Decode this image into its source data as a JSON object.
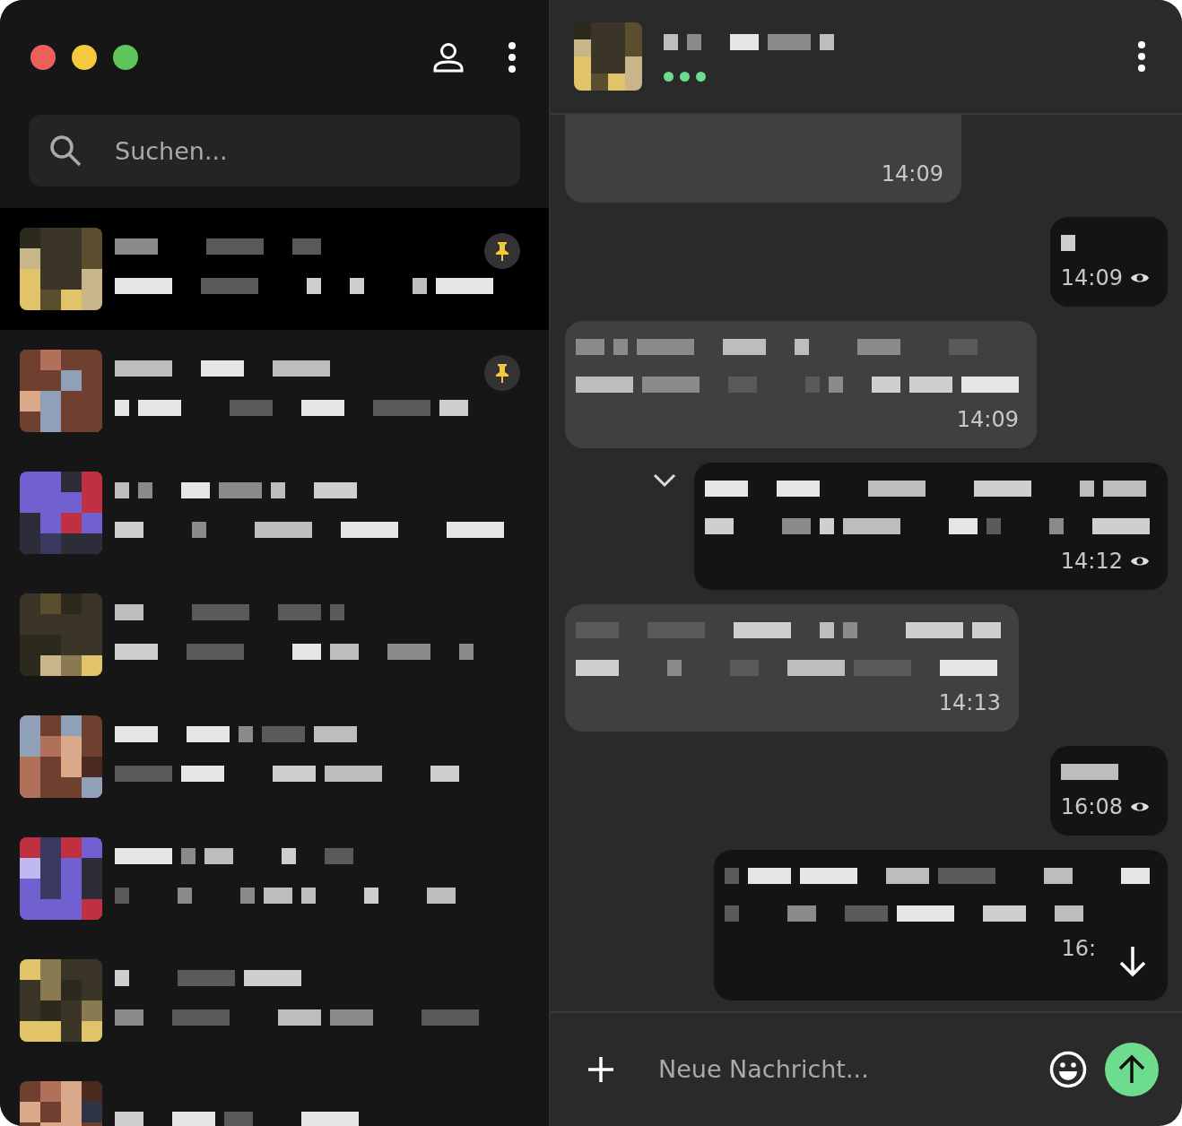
{
  "window": {
    "controls": [
      {
        "color": "#ee5f5b"
      },
      {
        "color": "#f5c93c"
      },
      {
        "color": "#5dc55a"
      }
    ]
  },
  "sidebar": {
    "search": {
      "placeholder": "Suchen..."
    },
    "chats": [
      {
        "selected": true,
        "pinned": true
      },
      {
        "selected": false,
        "pinned": true
      },
      {
        "selected": false,
        "pinned": false
      },
      {
        "selected": false,
        "pinned": false
      },
      {
        "selected": false,
        "pinned": false
      },
      {
        "selected": false,
        "pinned": false
      },
      {
        "selected": false,
        "pinned": false
      },
      {
        "selected": false,
        "pinned": false
      }
    ]
  },
  "conversation": {
    "header": {
      "typing": true
    },
    "messages": [
      {
        "kind": "incoming",
        "time": "14:09",
        "seen": false,
        "options": false
      },
      {
        "kind": "outgoing",
        "short": true,
        "time": "14:09",
        "seen": true,
        "options": false
      },
      {
        "kind": "incoming",
        "short": false,
        "time": "14:09",
        "seen": false,
        "options": false
      },
      {
        "kind": "outgoing",
        "short": false,
        "time": "14:12",
        "seen": true,
        "options": true
      },
      {
        "kind": "incoming",
        "short": false,
        "time": "14:13",
        "seen": false,
        "options": false
      },
      {
        "kind": "outgoing",
        "short": true,
        "time": "16:08",
        "seen": true,
        "options": false
      },
      {
        "kind": "outgoing",
        "short": false,
        "time": "16:",
        "seen": false,
        "options": false
      }
    ],
    "composer": {
      "placeholder": "Neue Nachricht..."
    }
  }
}
